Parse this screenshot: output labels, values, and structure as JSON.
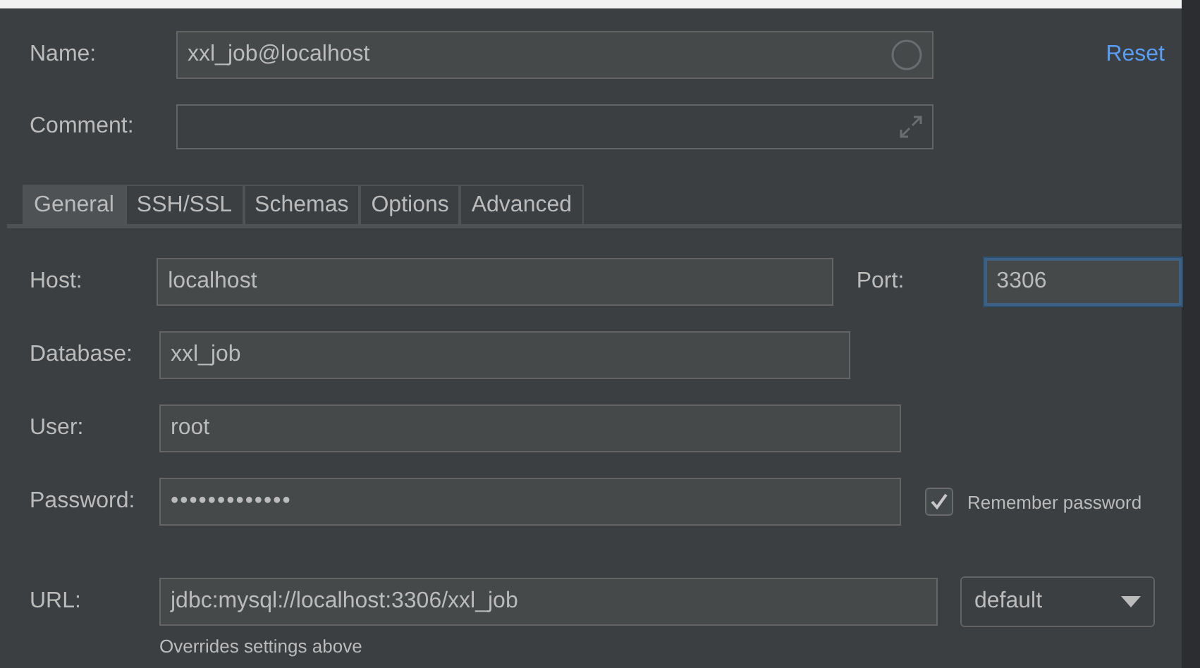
{
  "name": {
    "label": "Name:",
    "value": "xxl_job@localhost"
  },
  "reset": "Reset",
  "comment": {
    "label": "Comment:"
  },
  "tabs": [
    {
      "label": "General",
      "selected": true
    },
    {
      "label": "SSH/SSL",
      "selected": false
    },
    {
      "label": "Schemas",
      "selected": false
    },
    {
      "label": "Options",
      "selected": false
    },
    {
      "label": "Advanced",
      "selected": false
    }
  ],
  "host": {
    "label": "Host:",
    "value": "localhost"
  },
  "port": {
    "label": "Port:",
    "value": "3306",
    "focused": true
  },
  "database": {
    "label": "Database:",
    "value": "xxl_job"
  },
  "user": {
    "label": "User:",
    "value": "root"
  },
  "password": {
    "label": "Password:",
    "value": "•••••••••••••"
  },
  "remember": {
    "label": "Remember password",
    "checked": true
  },
  "url": {
    "label": "URL:",
    "value": "jdbc:mysql://localhost:3306/xxl_job",
    "hint": "Overrides settings above"
  },
  "driver": {
    "value": "default"
  }
}
